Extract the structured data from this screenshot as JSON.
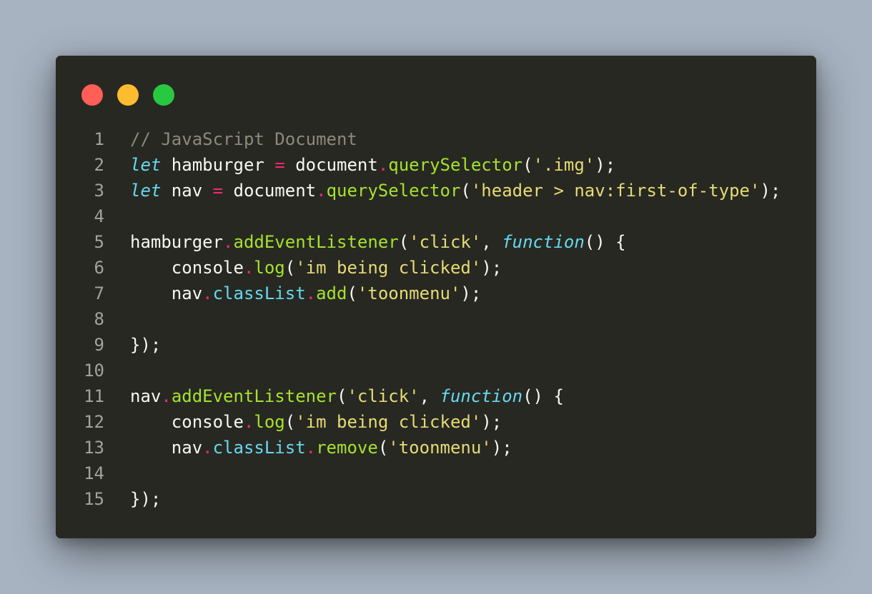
{
  "window": {
    "controls": [
      {
        "name": "close-button",
        "color": "#ff5f57"
      },
      {
        "name": "minimize-button",
        "color": "#febc2e"
      },
      {
        "name": "zoom-button",
        "color": "#28c840"
      }
    ]
  },
  "code": {
    "language": "javascript",
    "lines": [
      {
        "num": "1",
        "tokens": [
          {
            "t": "comment",
            "v": "// JavaScript Document"
          }
        ]
      },
      {
        "num": "2",
        "tokens": [
          {
            "t": "keyword",
            "v": "let"
          },
          {
            "t": "plain",
            "v": " hamburger "
          },
          {
            "t": "op",
            "v": "="
          },
          {
            "t": "plain",
            "v": " document"
          },
          {
            "t": "op",
            "v": "."
          },
          {
            "t": "func",
            "v": "querySelector"
          },
          {
            "t": "plain",
            "v": "("
          },
          {
            "t": "string",
            "v": "'.img'"
          },
          {
            "t": "plain",
            "v": ");"
          }
        ]
      },
      {
        "num": "3",
        "tokens": [
          {
            "t": "keyword",
            "v": "let"
          },
          {
            "t": "plain",
            "v": " nav "
          },
          {
            "t": "op",
            "v": "="
          },
          {
            "t": "plain",
            "v": " document"
          },
          {
            "t": "op",
            "v": "."
          },
          {
            "t": "func",
            "v": "querySelector"
          },
          {
            "t": "plain",
            "v": "("
          },
          {
            "t": "string",
            "v": "'header > nav:first-of-type'"
          },
          {
            "t": "plain",
            "v": ");"
          }
        ]
      },
      {
        "num": "4",
        "tokens": []
      },
      {
        "num": "5",
        "tokens": [
          {
            "t": "plain",
            "v": "hamburger"
          },
          {
            "t": "op",
            "v": "."
          },
          {
            "t": "func",
            "v": "addEventListener"
          },
          {
            "t": "plain",
            "v": "("
          },
          {
            "t": "string",
            "v": "'click'"
          },
          {
            "t": "plain",
            "v": ", "
          },
          {
            "t": "keyword",
            "v": "function"
          },
          {
            "t": "plain",
            "v": "() {"
          }
        ]
      },
      {
        "num": "6",
        "tokens": [
          {
            "t": "plain",
            "v": "    console"
          },
          {
            "t": "op",
            "v": "."
          },
          {
            "t": "func",
            "v": "log"
          },
          {
            "t": "plain",
            "v": "("
          },
          {
            "t": "string",
            "v": "'im being clicked'"
          },
          {
            "t": "plain",
            "v": ");"
          }
        ]
      },
      {
        "num": "7",
        "tokens": [
          {
            "t": "plain",
            "v": "    nav"
          },
          {
            "t": "op",
            "v": "."
          },
          {
            "t": "prop",
            "v": "classList"
          },
          {
            "t": "op",
            "v": "."
          },
          {
            "t": "func",
            "v": "add"
          },
          {
            "t": "plain",
            "v": "("
          },
          {
            "t": "string",
            "v": "'toonmenu'"
          },
          {
            "t": "plain",
            "v": ");"
          }
        ]
      },
      {
        "num": "8",
        "tokens": []
      },
      {
        "num": "9",
        "tokens": [
          {
            "t": "plain",
            "v": "});"
          }
        ]
      },
      {
        "num": "10",
        "tokens": []
      },
      {
        "num": "11",
        "tokens": [
          {
            "t": "plain",
            "v": "nav"
          },
          {
            "t": "op",
            "v": "."
          },
          {
            "t": "func",
            "v": "addEventListener"
          },
          {
            "t": "plain",
            "v": "("
          },
          {
            "t": "string",
            "v": "'click'"
          },
          {
            "t": "plain",
            "v": ", "
          },
          {
            "t": "keyword",
            "v": "function"
          },
          {
            "t": "plain",
            "v": "() {"
          }
        ]
      },
      {
        "num": "12",
        "tokens": [
          {
            "t": "plain",
            "v": "    console"
          },
          {
            "t": "op",
            "v": "."
          },
          {
            "t": "func",
            "v": "log"
          },
          {
            "t": "plain",
            "v": "("
          },
          {
            "t": "string",
            "v": "'im being clicked'"
          },
          {
            "t": "plain",
            "v": ");"
          }
        ]
      },
      {
        "num": "13",
        "tokens": [
          {
            "t": "plain",
            "v": "    nav"
          },
          {
            "t": "op",
            "v": "."
          },
          {
            "t": "prop",
            "v": "classList"
          },
          {
            "t": "op",
            "v": "."
          },
          {
            "t": "func",
            "v": "remove"
          },
          {
            "t": "plain",
            "v": "("
          },
          {
            "t": "string",
            "v": "'toonmenu'"
          },
          {
            "t": "plain",
            "v": ");"
          }
        ]
      },
      {
        "num": "14",
        "tokens": []
      },
      {
        "num": "15",
        "tokens": [
          {
            "t": "plain",
            "v": "});"
          }
        ]
      }
    ]
  }
}
